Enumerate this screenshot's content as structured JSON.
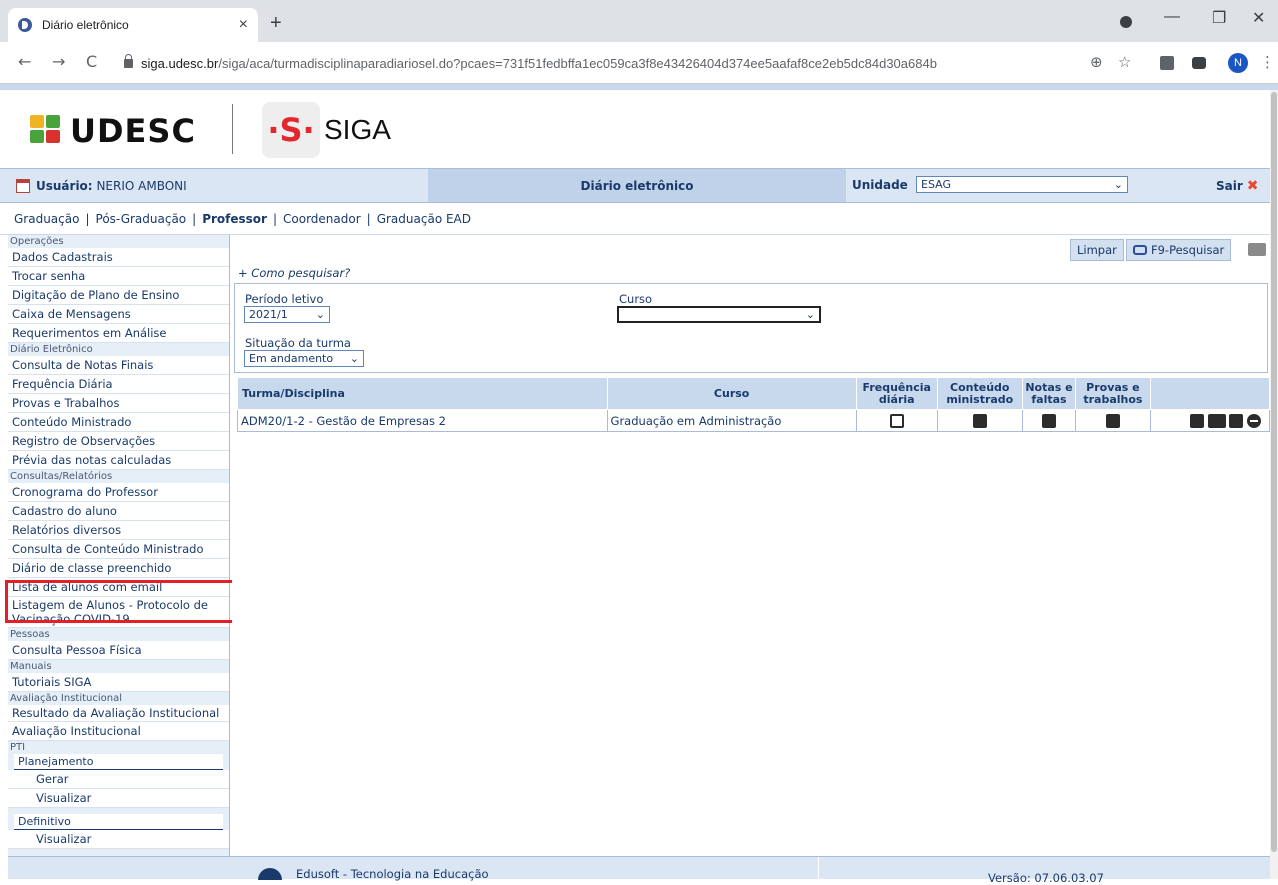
{
  "browser": {
    "tab_title": "Diário eletrônico",
    "tab_close": "×",
    "new_tab": "+",
    "url_host": "siga.udesc.br",
    "url_path": "/siga/aca/turmadisciplinaparadiariosel.do?pcaes=731f51fedbffa1ec059ca3f8e43426404d374ee5aafaf8ce2eb5dc84d30a684b",
    "profile_initial": "N",
    "back": "←",
    "forward": "→",
    "reload": "C",
    "zoom": "⊕",
    "star": "☆",
    "minimize": "—",
    "restore": "❐",
    "close": "✕",
    "menu": "⋮"
  },
  "header": {
    "udesc_logo": "UDESC",
    "siga_logo": "SIGA",
    "siga_glyph": "·S·"
  },
  "infobar": {
    "user_label": "Usuário:",
    "user_name": "NERIO AMBONI",
    "title": "Diário eletrônico",
    "unit_label": "Unidade",
    "unit_value": "ESAG",
    "logout": "Sair",
    "logout_icon": "✖"
  },
  "modules": {
    "items": [
      "Graduação",
      "Pós-Graduação",
      "Professor",
      "Coordenador",
      "Graduação EAD"
    ],
    "active": "Professor",
    "separator": "|"
  },
  "sidebar": {
    "sec_operacoes": "Operações",
    "operacoes": [
      "Dados Cadastrais",
      "Trocar senha",
      "Digitação de Plano de Ensino",
      "Caixa de Mensagens",
      "Requerimentos em Análise"
    ],
    "sec_diario": "Diário Eletrônico",
    "diario": [
      "Consulta de Notas Finais",
      "Frequência Diária",
      "Provas e Trabalhos",
      "Conteúdo Ministrado",
      "Registro de Observações",
      "Prévia das notas calculadas"
    ],
    "sec_consultas": "Consultas/Relatórios",
    "consultas": [
      "Cronograma do Professor",
      "Cadastro do aluno",
      "Relatórios diversos",
      "Consulta de Conteúdo Ministrado",
      "Diário de classe preenchido",
      "Lista de alunos com email"
    ],
    "listagem": "Listagem de Alunos - Protocolo de Vacinação COVID-19",
    "sec_pessoas": "Pessoas",
    "pessoas": "Consulta Pessoa Física",
    "sec_manuais": "Manuais",
    "manuais": "Tutoriais SIGA",
    "sec_avaliacao": "Avaliação Institucional",
    "avaliacao": [
      "Resultado da Avaliação Institucional",
      "Avaliação Institucional"
    ],
    "sec_pti": "PTI",
    "planejamento": "Planejamento",
    "gerar": "Gerar",
    "visualizar1": "Visualizar",
    "definitivo": "Definitivo",
    "visualizar2": "Visualizar"
  },
  "main": {
    "clear_btn": "Limpar",
    "search_btn": "F9-Pesquisar",
    "howto": "+ Como pesquisar?",
    "periodo_label": "Período letivo",
    "periodo_value": "2021/1",
    "curso_label": "Curso",
    "curso_value": "",
    "situacao_label": "Situação da turma",
    "situacao_value": "Em andamento",
    "chevron": "⌄"
  },
  "table": {
    "headers": [
      "Turma/Disciplina",
      "Curso",
      "Frequência diária",
      "Conteúdo ministrado",
      "Notas e faltas",
      "Provas e trabalhos",
      ""
    ],
    "rows": [
      {
        "turma": "ADM20/1-2 - Gestão de Empresas 2",
        "curso": "Graduação em Administração"
      }
    ]
  },
  "footer": {
    "left": "Edusoft - Tecnologia na Educação",
    "right": "Versão: 07.06.03.07"
  }
}
